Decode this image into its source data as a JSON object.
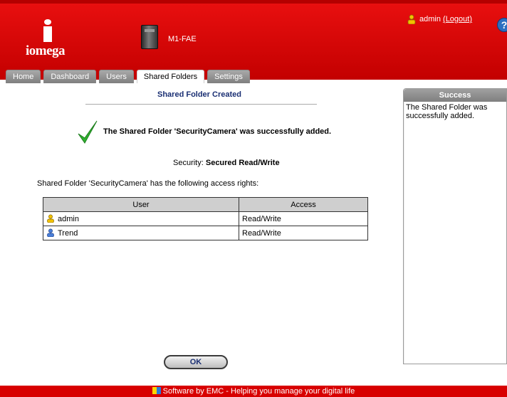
{
  "header": {
    "brand": "iomega",
    "device_name": "M1-FAE",
    "user": "admin",
    "logout_label": "(Logout)",
    "help_icon": "?"
  },
  "tabs": [
    {
      "label": "Home",
      "active": false
    },
    {
      "label": "Dashboard",
      "active": false
    },
    {
      "label": "Users",
      "active": false
    },
    {
      "label": "Shared Folders",
      "active": true
    },
    {
      "label": "Settings",
      "active": false
    }
  ],
  "main": {
    "title": "Shared Folder Created",
    "success_message": "The Shared Folder 'SecurityCamera' was successfully added.",
    "security_label": "Security:",
    "security_value": "Secured Read/Write",
    "rights_text": "Shared Folder 'SecurityCamera' has the following access rights:",
    "table": {
      "headers": [
        "User",
        "Access"
      ],
      "rows": [
        {
          "user": "admin",
          "access": "Read/Write",
          "icon": "user-yellow-icon"
        },
        {
          "user": "Trend",
          "access": "Read/Write",
          "icon": "user-blue-icon"
        }
      ]
    },
    "ok_label": "OK"
  },
  "side_panel": {
    "title": "Success",
    "body": "The Shared Folder was successfully added."
  },
  "footer": {
    "text": "Software by EMC - Helping you manage your digital life"
  },
  "colors": {
    "header_red": "#d80000",
    "title_blue": "#1a2f73",
    "check_green": "#2fb12f"
  }
}
